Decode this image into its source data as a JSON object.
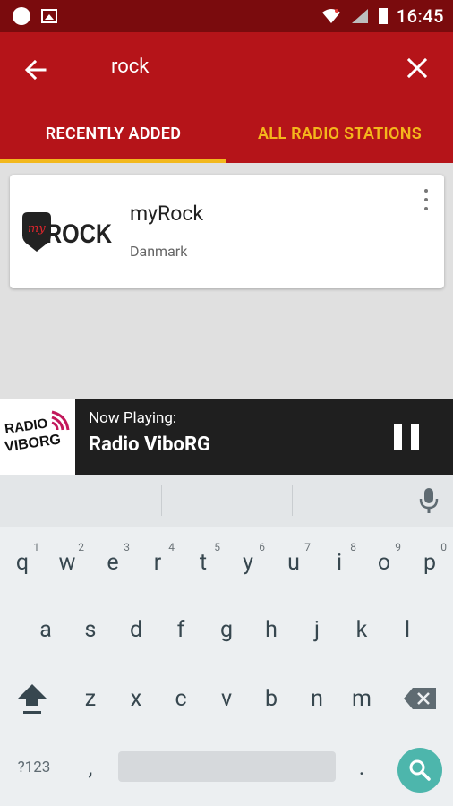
{
  "status_bar": {
    "time": "16:45"
  },
  "toolbar": {
    "query": "rock",
    "back_icon": "arrow-left-icon",
    "close_icon": "close-icon"
  },
  "tabs": [
    {
      "label": "RECENTLY ADDED",
      "active": true
    },
    {
      "label": "ALL RADIO STATIONS",
      "active": false
    }
  ],
  "results": [
    {
      "logo_text_script": "my",
      "logo_text": "ROCK",
      "name": "myRock",
      "country": "Danmark"
    }
  ],
  "player": {
    "label": "Now Playing:",
    "station": "Radio ViboRG",
    "logo_line1": "RADIO",
    "logo_line2": "VIBORG"
  },
  "keyboard": {
    "row1": [
      {
        "k": "q",
        "h": "1"
      },
      {
        "k": "w",
        "h": "2"
      },
      {
        "k": "e",
        "h": "3"
      },
      {
        "k": "r",
        "h": "4"
      },
      {
        "k": "t",
        "h": "5"
      },
      {
        "k": "y",
        "h": "6"
      },
      {
        "k": "u",
        "h": "7"
      },
      {
        "k": "i",
        "h": "8"
      },
      {
        "k": "o",
        "h": "9"
      },
      {
        "k": "p",
        "h": "0"
      }
    ],
    "row2": [
      "a",
      "s",
      "d",
      "f",
      "g",
      "h",
      "j",
      "k",
      "l"
    ],
    "row3": [
      "z",
      "x",
      "c",
      "v",
      "b",
      "n",
      "m"
    ],
    "symbols_key": "?123",
    "comma_key": ",",
    "period_key": "."
  },
  "colors": {
    "status_bar": "#7a0b0d",
    "toolbar": "#b51419",
    "tab_indicator": "#f2b81d",
    "inactive_tab": "#f4b61c",
    "search_key": "#4db6ac"
  }
}
